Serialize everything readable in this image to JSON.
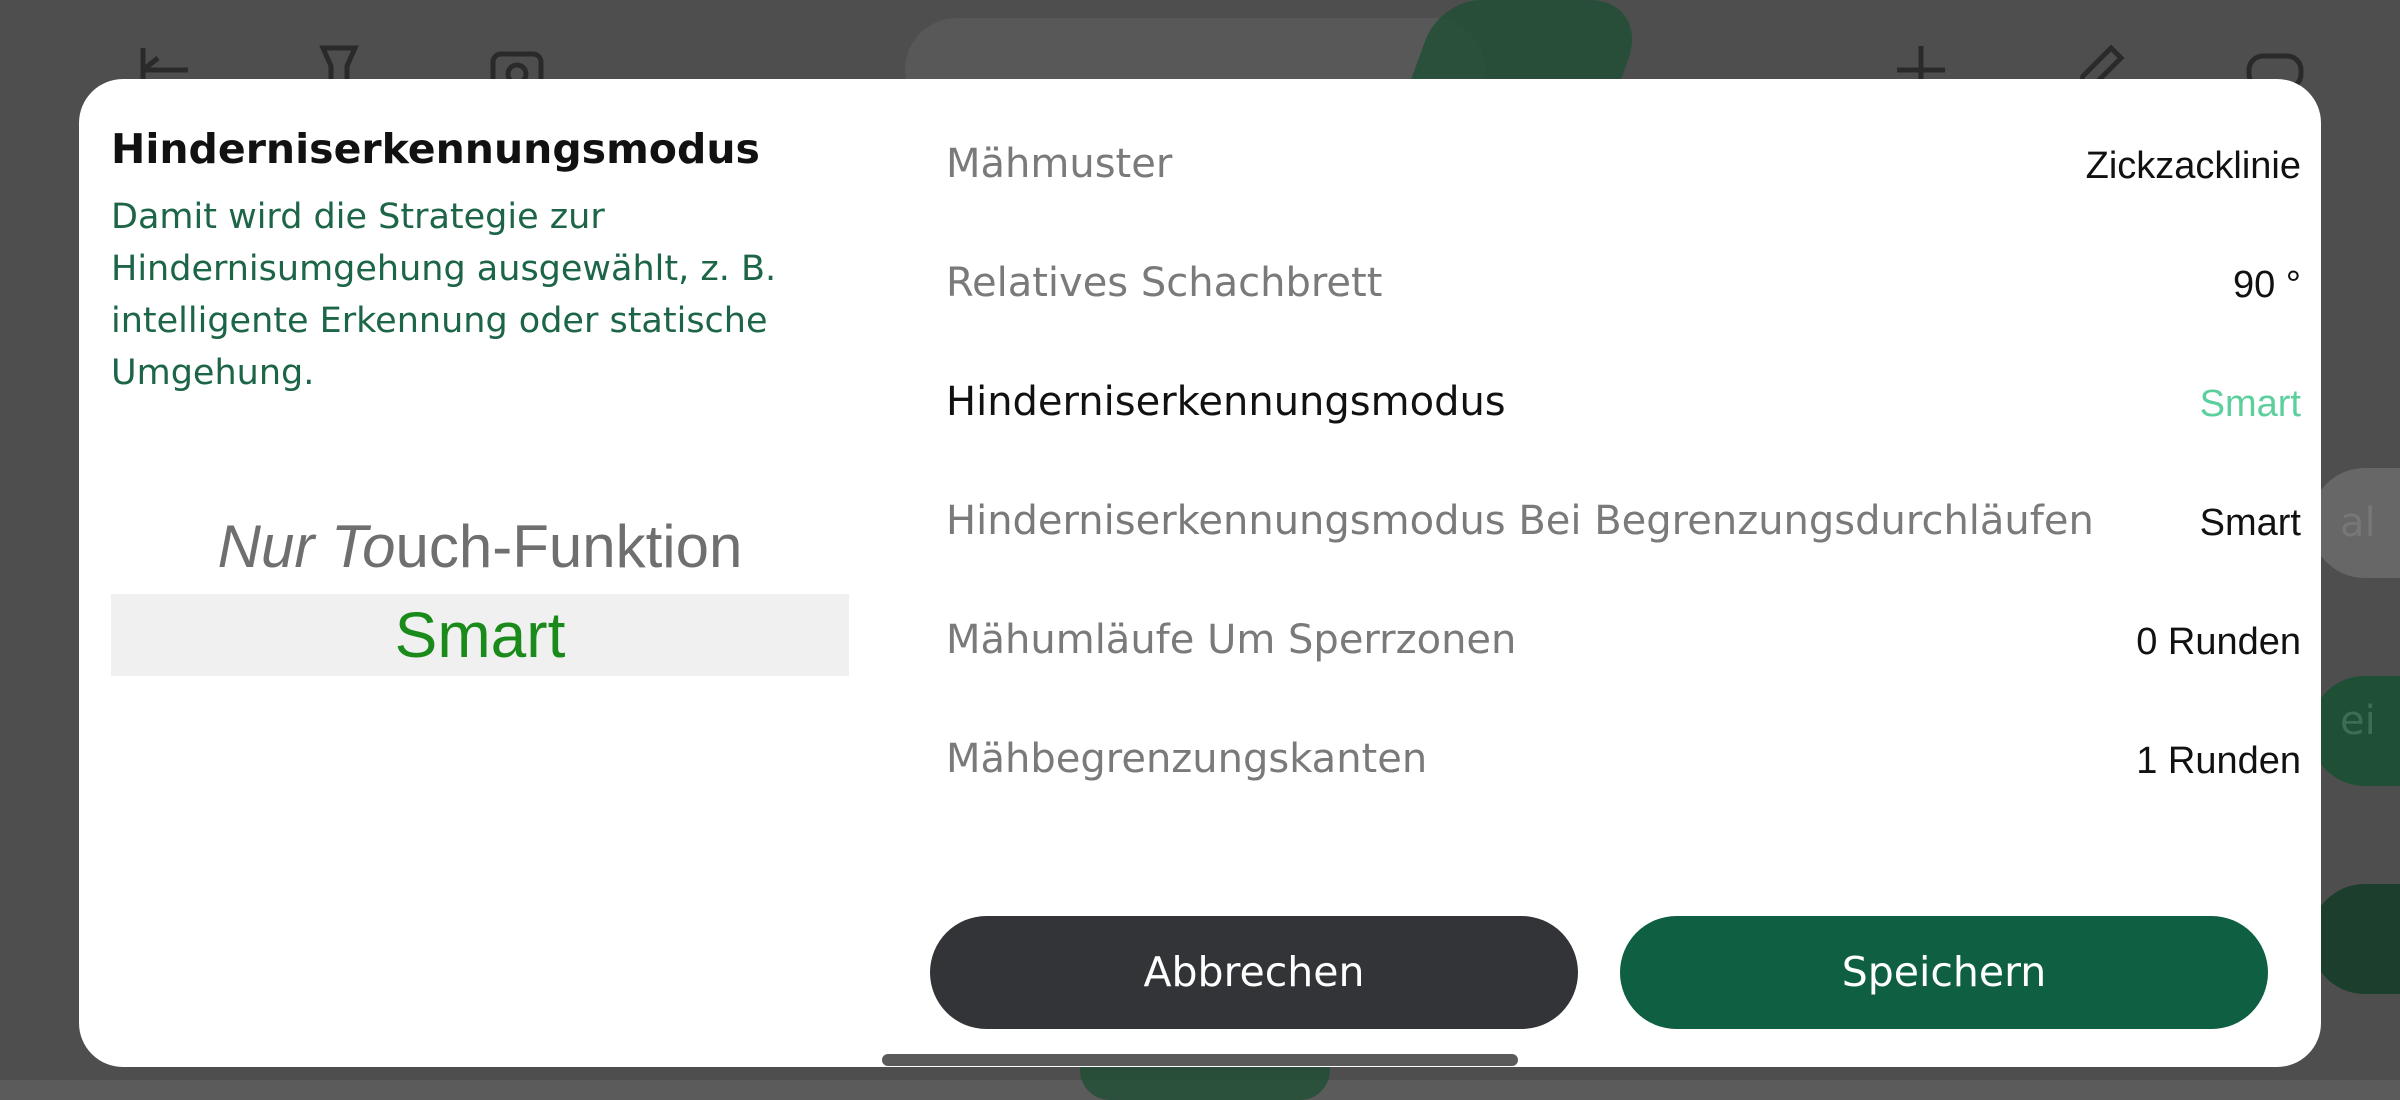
{
  "background": {
    "top_icons": [
      "back-icon",
      "flashlight-icon",
      "camera-icon",
      "location-pin-icon",
      "plus-icon",
      "edit-icon",
      "gamepad-icon"
    ],
    "partial_right_text_1": "al",
    "partial_right_text_2": "ei"
  },
  "dialog": {
    "left": {
      "title": "Hinderniserkennungsmodus",
      "description": "Damit wird die Strategie zur Hindernisumgehung ausgewählt, z. B. intelligente Erkennung oder statische Umgehung.",
      "picker": {
        "option_above_italic": "Nur To",
        "option_above_rest": "uch-Funktion",
        "selected": "Smart"
      }
    },
    "settings": [
      {
        "label": "Mähmuster",
        "value": "Zickzacklinie"
      },
      {
        "label": "Relatives Schachbrett",
        "value": "90 °"
      },
      {
        "label": "Hinderniserkennungsmodus",
        "value": "Smart"
      },
      {
        "label": "Hinderniserkennungsmodus Bei Begrenzungsdurchläufen",
        "value": "Smart"
      },
      {
        "label": "Mähumläufe Um Sperrzonen",
        "value": "0 Runden"
      },
      {
        "label": "Mähbegrenzungskanten",
        "value": "1 Runden"
      }
    ],
    "buttons": {
      "cancel": "Abbrechen",
      "save": "Speichern"
    },
    "colors": {
      "accent_green": "#0f6043",
      "value_accent": "#5ccf9d",
      "picker_selected": "#1a8a1a"
    }
  }
}
